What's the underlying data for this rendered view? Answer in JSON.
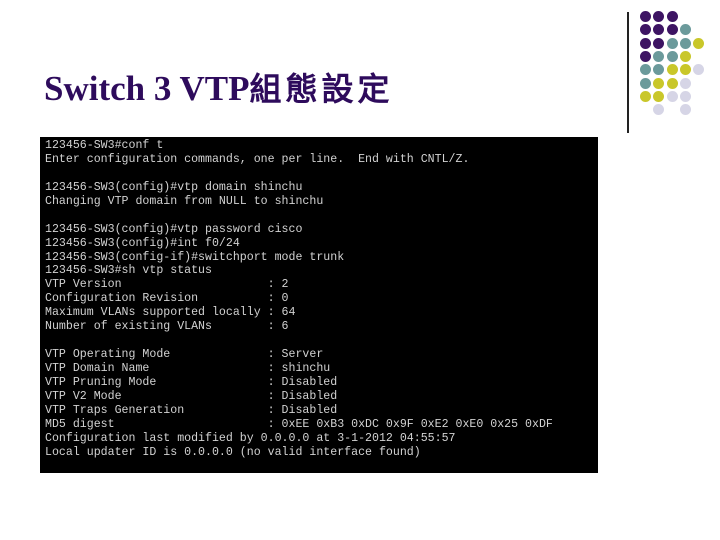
{
  "slide": {
    "title_latin": "Switch 3 VTP",
    "title_cjk": "組態設定",
    "title_color": "#2e0b5c"
  },
  "decoration": {
    "dot_colors": {
      "purple": "#3d1463",
      "teal": "#6b9a9b",
      "yellow": "#c9c72a",
      "lavender": "#d6d5e6"
    },
    "dot_grid": [
      [
        "purple",
        "purple",
        "purple",
        null,
        null
      ],
      [
        "purple",
        "purple",
        "purple",
        "teal",
        null
      ],
      [
        "purple",
        "purple",
        "teal",
        "teal",
        "yellow"
      ],
      [
        "purple",
        "teal",
        "teal",
        "yellow",
        null
      ],
      [
        "teal",
        "teal",
        "yellow",
        "yellow",
        "lavender"
      ],
      [
        "teal",
        "yellow",
        "yellow",
        "lavender",
        null
      ],
      [
        "yellow",
        "yellow",
        "lavender",
        "lavender",
        null
      ],
      [
        null,
        "lavender",
        null,
        "lavender",
        null
      ]
    ]
  },
  "terminal": {
    "lines": [
      "123456-SW3#conf t",
      "Enter configuration commands, one per line.  End with CNTL/Z.",
      "",
      "123456-SW3(config)#vtp domain shinchu",
      "Changing VTP domain from NULL to shinchu",
      "",
      "123456-SW3(config)#vtp password cisco",
      "123456-SW3(config)#int f0/24",
      "123456-SW3(config-if)#switchport mode trunk",
      "123456-SW3#sh vtp status",
      "VTP Version                     : 2",
      "Configuration Revision          : 0",
      "Maximum VLANs supported locally : 64",
      "Number of existing VLANs        : 6",
      "",
      "VTP Operating Mode              : Server",
      "VTP Domain Name                 : shinchu",
      "VTP Pruning Mode                : Disabled",
      "VTP V2 Mode                     : Disabled",
      "VTP Traps Generation            : Disabled",
      "MD5 digest                      : 0xEE 0xB3 0xDC 0x9F 0xE2 0xE0 0x25 0xDF",
      "Configuration last modified by 0.0.0.0 at 3-1-2012 04:55:57",
      "Local updater ID is 0.0.0.0 (no valid interface found)"
    ]
  }
}
